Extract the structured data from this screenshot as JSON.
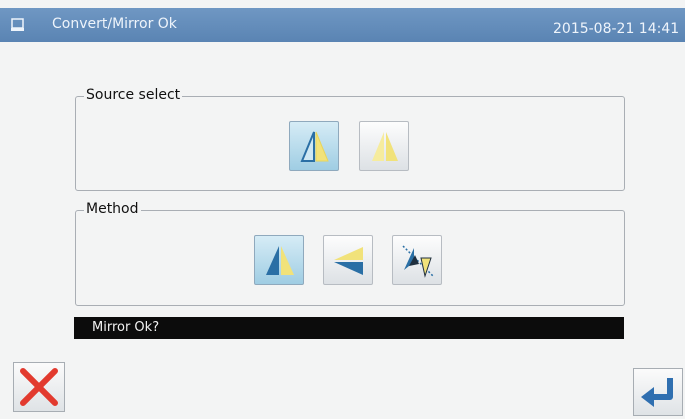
{
  "titlebar": {
    "title": "Convert/Mirror  Ok",
    "clock": "2015-08-21 14:41",
    "icon": "document-icon"
  },
  "source_select": {
    "label": "Source select",
    "options": [
      {
        "icon": "mirror-source-original-icon",
        "selected": true
      },
      {
        "icon": "mirror-source-copy-icon",
        "selected": false
      }
    ]
  },
  "method": {
    "label": "Method",
    "options": [
      {
        "icon": "mirror-horizontal-icon",
        "selected": true
      },
      {
        "icon": "mirror-vertical-icon",
        "selected": false
      },
      {
        "icon": "mirror-diagonal-icon",
        "selected": false
      }
    ]
  },
  "message": "Mirror Ok?",
  "buttons": {
    "cancel": {
      "icon": "close-x-icon",
      "color": "#e23a2e"
    },
    "confirm": {
      "icon": "enter-return-icon",
      "color": "#2f6fb0"
    }
  },
  "colors": {
    "titlebar": "#6a91be",
    "accent_blue": "#2a6fa5",
    "accent_yellow": "#f1e27a"
  }
}
